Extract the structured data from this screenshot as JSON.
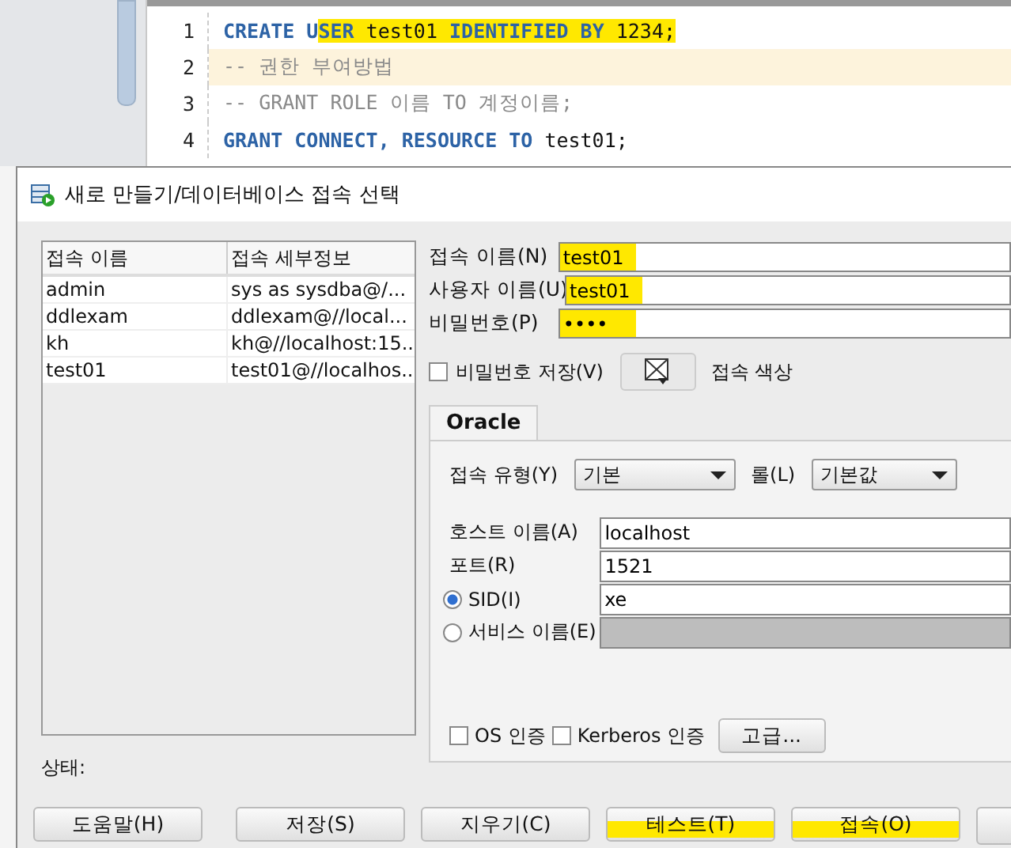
{
  "editor": {
    "lines": [
      {
        "number": "1",
        "current": false,
        "tokens": [
          {
            "text": "CREATE U",
            "kind": "keyword",
            "highlighted": false
          },
          {
            "text": "SER",
            "kind": "keyword",
            "highlighted": true
          },
          {
            "text": " test01 ",
            "kind": "plain",
            "highlighted": true
          },
          {
            "text": "IDENTIFIED BY",
            "kind": "keyword",
            "highlighted": true
          },
          {
            "text": " 1234;",
            "kind": "plain",
            "highlighted": true
          }
        ]
      },
      {
        "number": "2",
        "current": true,
        "tokens": [
          {
            "text": "-- 권한 부여방법",
            "kind": "comment",
            "highlighted": false
          }
        ]
      },
      {
        "number": "3",
        "current": false,
        "tokens": [
          {
            "text": "-- GRANT ROLE 이름 TO 계정이름;",
            "kind": "comment",
            "highlighted": false
          }
        ]
      },
      {
        "number": "4",
        "current": false,
        "tokens": [
          {
            "text": "GRANT CONNECT, RESOURCE TO",
            "kind": "keyword",
            "highlighted": false
          },
          {
            "text": " test01;",
            "kind": "plain",
            "highlighted": false
          }
        ]
      }
    ]
  },
  "dialog": {
    "title": "새로 만들기/데이터베이스 접속 선택",
    "connections": {
      "columns": [
        "접속 이름",
        "접속 세부정보"
      ],
      "rows": [
        {
          "name": "admin",
          "details": "sys as sysdba@/...",
          "selected": false
        },
        {
          "name": "ddlexam",
          "details": "ddlexam@//local...",
          "selected": false
        },
        {
          "name": "kh",
          "details": "kh@//localhost:15...",
          "selected": false
        },
        {
          "name": "test01",
          "details": "test01@//localhos...",
          "selected": false
        }
      ]
    },
    "fields": [
      {
        "label": "접속 이름(N)",
        "value": "test01",
        "highlighted": true
      },
      {
        "label": "사용자 이름(U)",
        "value": "test01",
        "highlighted": true
      },
      {
        "label": "비밀번호(P)",
        "value": "••••",
        "highlighted": true
      }
    ],
    "save_password": {
      "label": "비밀번호 저장(V)",
      "checked": false
    },
    "connection_color": {
      "label": "접속 색상"
    },
    "tab": {
      "label": "Oracle",
      "selected": true
    },
    "connection_type": {
      "label": "접속 유형(Y)",
      "value": "기본"
    },
    "role": {
      "label": "롤(L)",
      "value": "기본값"
    },
    "host": {
      "label": "호스트 이름(A)",
      "value": "localhost"
    },
    "port": {
      "label": "포트(R)",
      "value": "1521"
    },
    "sid": {
      "label": "SID(I)",
      "value": "xe",
      "selected": true
    },
    "service": {
      "label": "서비스 이름(E)",
      "selected": false
    },
    "os_auth": {
      "label": "OS 인증",
      "checked": false
    },
    "kerberos_auth": {
      "label": "Kerberos 인증",
      "checked": false
    },
    "advanced_button": "고급...",
    "status": "상태:",
    "buttons": [
      {
        "label": "도움말(H)",
        "highlighted": false
      },
      {
        "label": "저장(S)",
        "highlighted": false
      },
      {
        "label": "지우기(C)",
        "highlighted": false
      },
      {
        "label": "테스트(T)",
        "highlighted": true
      },
      {
        "label": "접속(O)",
        "highlighted": true
      }
    ]
  }
}
